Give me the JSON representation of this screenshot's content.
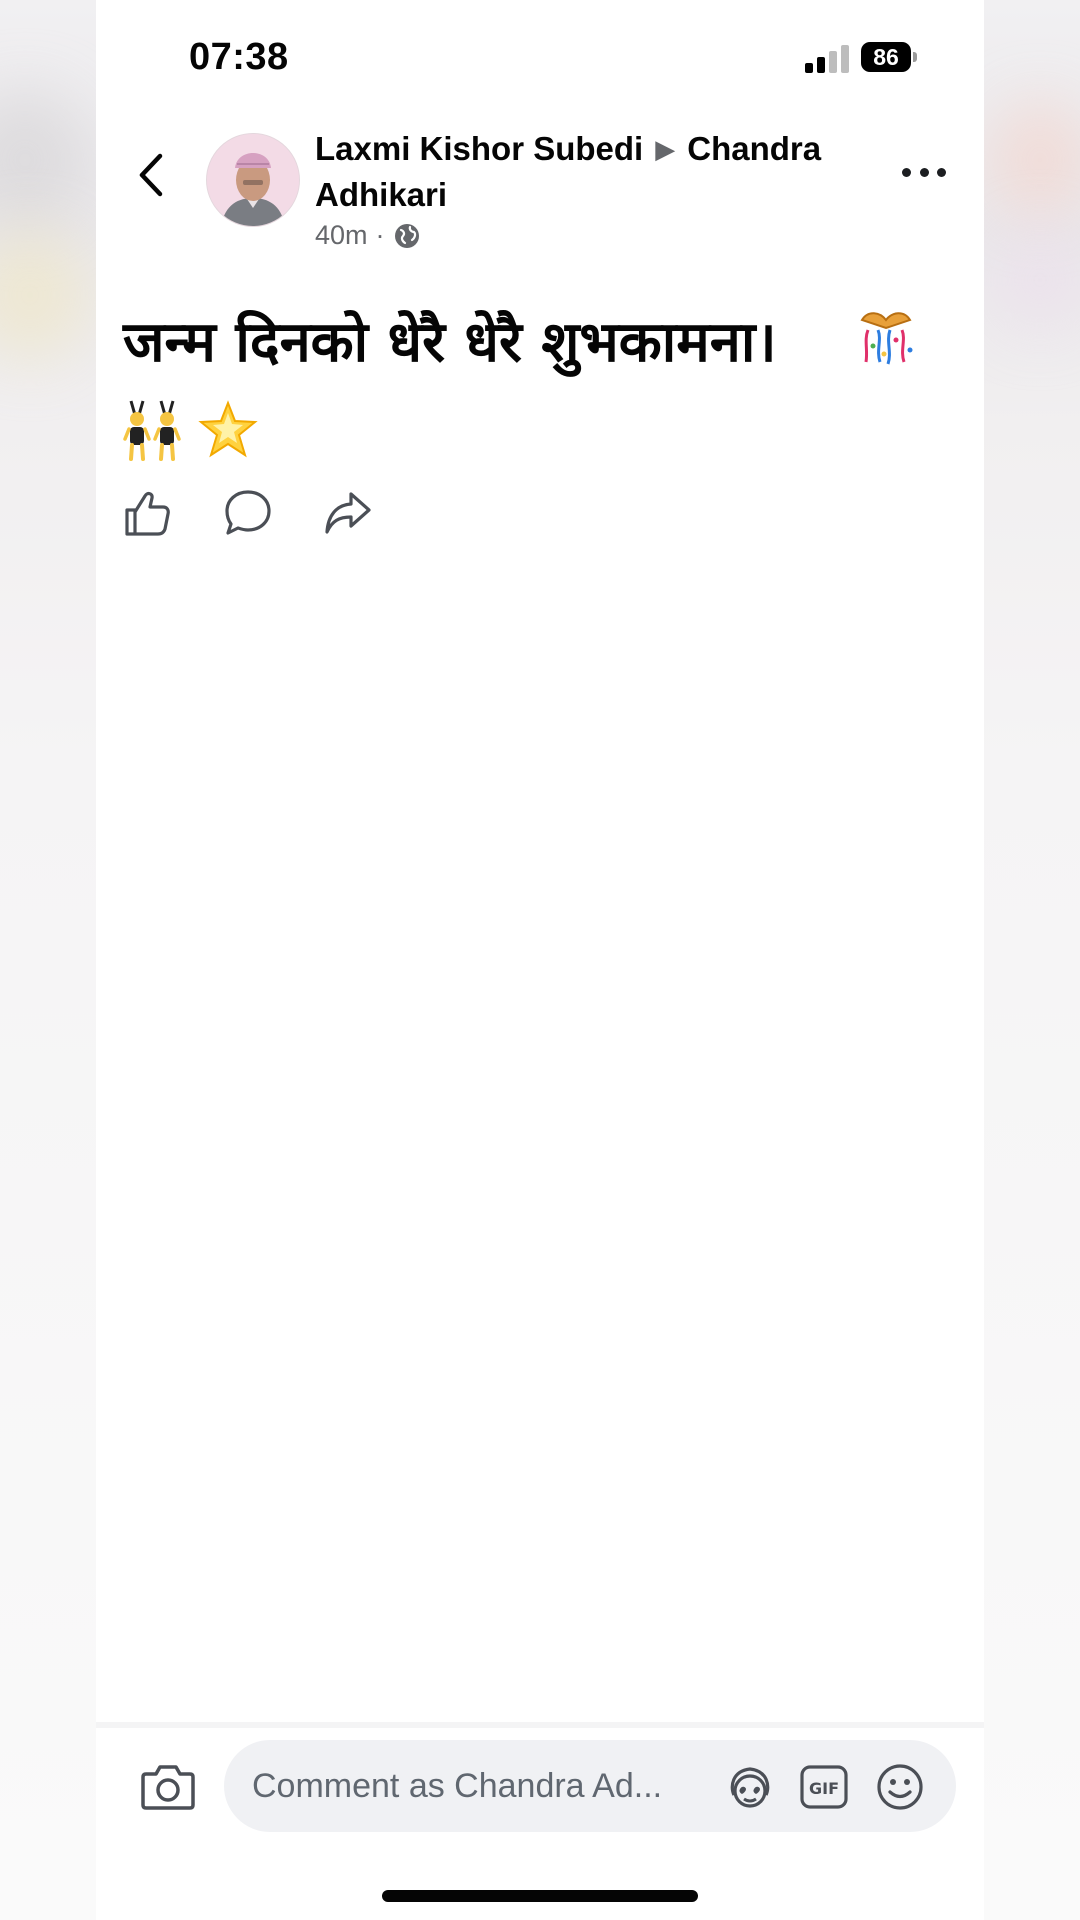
{
  "status_bar": {
    "time": "07:38",
    "battery": "86"
  },
  "post": {
    "author": "Laxmi Kishor Subedi",
    "recipient": "Chandra Adhikari",
    "recipient_line1": "Chandra",
    "recipient_line2": "Adhikari",
    "timestamp": "40m",
    "separator": "·",
    "audience_icon": "globe-icon",
    "text": "जन्म दिनको धेरै धेरै शुभकामना।",
    "emojis": [
      "confetti-ball",
      "people-with-bunny-ears",
      "glowing-star"
    ]
  },
  "actions": [
    {
      "name": "like",
      "icon": "thumbs-up-icon"
    },
    {
      "name": "comment",
      "icon": "speech-bubble-icon"
    },
    {
      "name": "share",
      "icon": "share-arrow-icon"
    }
  ],
  "comment_bar": {
    "placeholder": "Comment as Chandra Ad...",
    "icons": [
      "camera-icon",
      "avatar-sticker-icon",
      "gif-icon",
      "smiley-icon"
    ]
  },
  "colors": {
    "background": "#ffffff",
    "text": "#050505",
    "secondary_text": "#65676b",
    "input_bg": "#f0f1f4"
  }
}
